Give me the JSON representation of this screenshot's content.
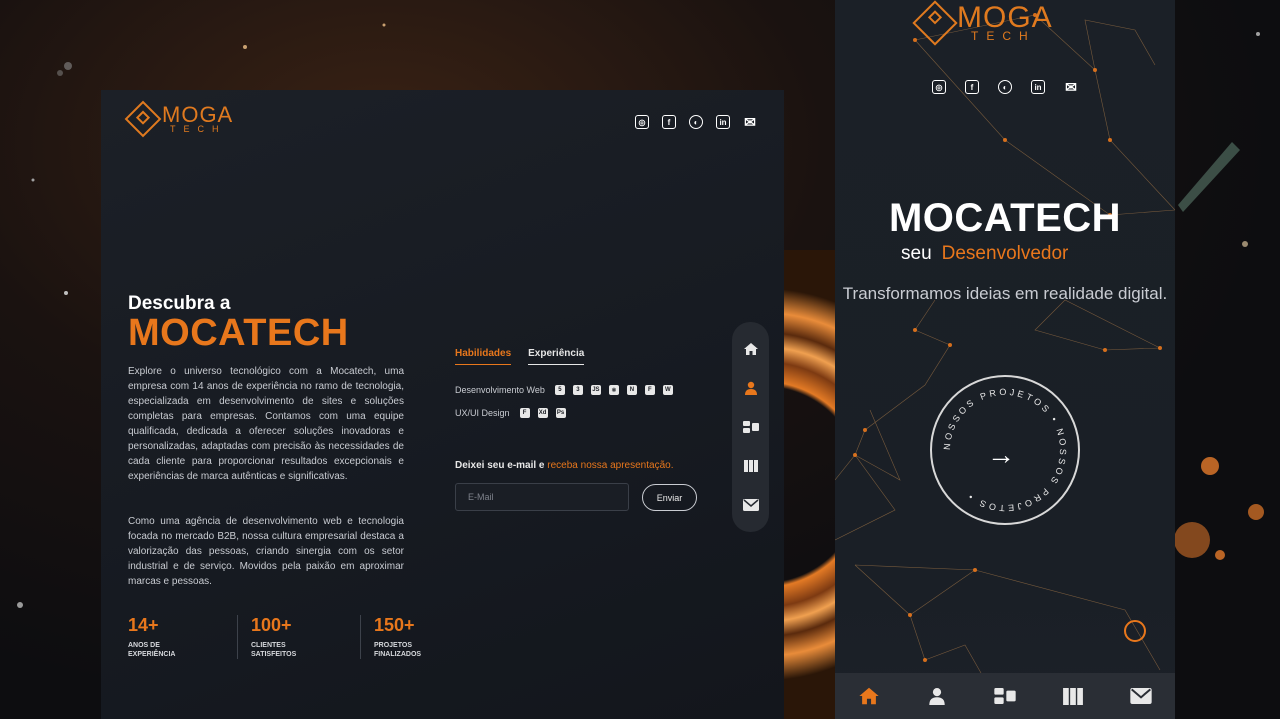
{
  "brand": {
    "logo_main": "MOGA",
    "logo_sub": "TECH"
  },
  "socials": [
    {
      "icon": "instagram-icon",
      "glyph": "◎"
    },
    {
      "icon": "facebook-icon",
      "glyph": "f"
    },
    {
      "icon": "github-icon",
      "glyph": "◐"
    },
    {
      "icon": "linkedin-icon",
      "glyph": "in"
    },
    {
      "icon": "mail-icon",
      "glyph": "✉"
    }
  ],
  "desktop": {
    "hero_small": "Descubra a",
    "hero_big": "MOCATECH",
    "paragraph_1": "Explore o universo tecnológico com a Mocatech, uma empresa com 14 anos de experiência no ramo de tecnologia, especializada em desenvolvimento de sites e soluções completas para empresas. Contamos com uma equipe qualificada, dedicada a oferecer soluções inovadoras e personalizadas, adaptadas com precisão às necessidades de cada cliente para proporcionar resultados excepcionais e experiências de marca autênticas e significativas.",
    "paragraph_2": "Como uma agência de desenvolvimento web e tecnologia focada no mercado B2B, nossa cultura empresarial destaca a valorização das pessoas, criando sinergia com os setor industrial e de serviço. Movidos pela paixão em aproximar marcas e pessoas.",
    "stats": [
      {
        "num": "14+",
        "label": "ANOS DE EXPERIÊNCIA"
      },
      {
        "num": "100+",
        "label": "CLIENTES SATISFEITOS"
      },
      {
        "num": "150+",
        "label": "PROJETOS FINALIZADOS"
      }
    ],
    "tabs": {
      "skills": "Habilidades",
      "experience": "Experiência"
    },
    "skills": [
      {
        "label": "Desenvolvimento Web",
        "icons": [
          "5",
          "3",
          "JS",
          "⚛",
          "N",
          "F",
          "W"
        ]
      },
      {
        "label": "UX/UI Design",
        "icons": [
          "F",
          "Xd",
          "Ps"
        ]
      }
    ],
    "newsletter": {
      "text": "Deixei seu e-mail e ",
      "highlight": "receba nossa apresentação.",
      "placeholder": "E-Mail",
      "button": "Enviar"
    },
    "side_nav": [
      "home-icon",
      "user-icon",
      "services-icon",
      "portfolio-icon",
      "mail-icon"
    ]
  },
  "mobile": {
    "title": "MOCATECH",
    "sub_1": "seu",
    "sub_2": "Desenvolvedor",
    "desc": "Transformamos ideias em realidade digital.",
    "badge_text": "NOSSOS PROJETOS • NOSSOS PROJETOS •",
    "badge_arrow": "→",
    "bottom_nav": [
      "home-icon",
      "user-icon",
      "services-icon",
      "portfolio-icon",
      "mail-icon"
    ]
  },
  "colors": {
    "accent": "#e8771c",
    "panel": "#1b2027"
  }
}
